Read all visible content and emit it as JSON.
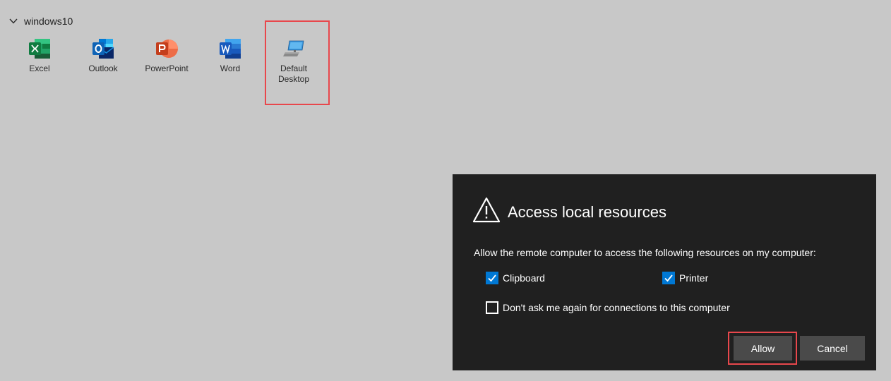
{
  "group": {
    "name": "windows10",
    "chevron_icon": "chevron-down-icon"
  },
  "apps": [
    {
      "label": "Excel",
      "icon": "excel-icon",
      "color": "#1d6f42"
    },
    {
      "label": "Outlook",
      "icon": "outlook-icon",
      "color": "#0f63b6"
    },
    {
      "label": "PowerPoint",
      "icon": "powerpoint-icon",
      "color": "#c43e1c"
    },
    {
      "label": "Word",
      "icon": "word-icon",
      "color": "#2b579a"
    },
    {
      "label": "Default Desktop",
      "icon": "desktop-computer-icon",
      "color": "#3a96dd"
    }
  ],
  "dialog": {
    "title": "Access local resources",
    "warning_icon": "warning-icon",
    "description": "Allow the remote computer to access the following resources on my computer:",
    "options": [
      {
        "label": "Clipboard",
        "checked": true
      },
      {
        "label": "Printer",
        "checked": true
      },
      {
        "label": "Don't ask me again for connections to this computer",
        "checked": false
      }
    ],
    "buttons": {
      "allow": "Allow",
      "cancel": "Cancel"
    }
  },
  "colors": {
    "background": "#c8c8c8",
    "dialog_background": "#202020",
    "accent": "#0078d4",
    "highlight": "#e8474c",
    "button": "#4a4a4a"
  }
}
